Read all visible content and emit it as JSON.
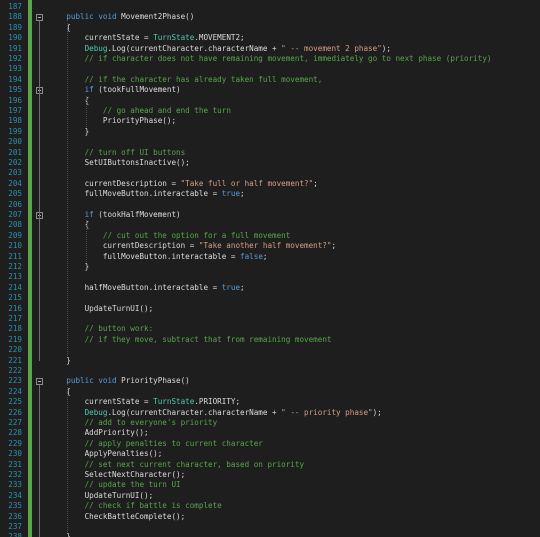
{
  "editor": {
    "colors": {
      "background": "#1e1e1e",
      "line_number": "#2b91af",
      "keyword": "#569cd6",
      "type": "#4ec9b0",
      "string": "#d69d85",
      "comment": "#57a64a",
      "text": "#dcdcdc",
      "change_bar": "#57a64a"
    },
    "fold_icon": "collapse-minus-icon",
    "lines": [
      {
        "n": "187",
        "segs": []
      },
      {
        "n": "188",
        "fold": true,
        "segs": [
          {
            "t": "    ",
            "c": "tx"
          },
          {
            "t": "public",
            "c": "kw"
          },
          {
            "t": " ",
            "c": "tx"
          },
          {
            "t": "void",
            "c": "kw"
          },
          {
            "t": " Movement2Phase()",
            "c": "tx"
          }
        ]
      },
      {
        "n": "189",
        "segs": [
          {
            "t": "    {",
            "c": "tx"
          }
        ]
      },
      {
        "n": "190",
        "segs": [
          {
            "t": "        currentState = ",
            "c": "tx"
          },
          {
            "t": "TurnState",
            "c": "ty"
          },
          {
            "t": ".MOVEMENT2;",
            "c": "tx"
          }
        ]
      },
      {
        "n": "191",
        "segs": [
          {
            "t": "        ",
            "c": "tx"
          },
          {
            "t": "Debug",
            "c": "ty"
          },
          {
            "t": ".Log(currentCharacter.characterName + ",
            "c": "tx"
          },
          {
            "t": "\" -- movement 2 phase\"",
            "c": "st"
          },
          {
            "t": ");",
            "c": "tx"
          }
        ]
      },
      {
        "n": "192",
        "segs": [
          {
            "t": "        ",
            "c": "tx"
          },
          {
            "t": "// if character does not have remaining movement, immediately go to next phase (priority)",
            "c": "cm"
          }
        ]
      },
      {
        "n": "193",
        "segs": []
      },
      {
        "n": "194",
        "segs": [
          {
            "t": "        ",
            "c": "tx"
          },
          {
            "t": "// if the character has already taken full movement,",
            "c": "cm"
          }
        ]
      },
      {
        "n": "195",
        "fold": true,
        "segs": [
          {
            "t": "        ",
            "c": "tx"
          },
          {
            "t": "if",
            "c": "kw"
          },
          {
            "t": " (tookFullMovement)",
            "c": "tx"
          }
        ]
      },
      {
        "n": "196",
        "segs": [
          {
            "t": "        {",
            "c": "tx"
          }
        ]
      },
      {
        "n": "197",
        "segs": [
          {
            "t": "            ",
            "c": "tx"
          },
          {
            "t": "// go ahead and end the turn",
            "c": "cm"
          }
        ]
      },
      {
        "n": "198",
        "segs": [
          {
            "t": "            PriorityPhase();",
            "c": "tx"
          }
        ]
      },
      {
        "n": "199",
        "segs": [
          {
            "t": "        }",
            "c": "tx"
          }
        ]
      },
      {
        "n": "200",
        "segs": []
      },
      {
        "n": "201",
        "segs": [
          {
            "t": "        ",
            "c": "tx"
          },
          {
            "t": "// turn off UI buttons",
            "c": "cm"
          }
        ]
      },
      {
        "n": "202",
        "segs": [
          {
            "t": "        SetUIButtonsInactive();",
            "c": "tx"
          }
        ]
      },
      {
        "n": "203",
        "segs": []
      },
      {
        "n": "204",
        "segs": [
          {
            "t": "        currentDescription = ",
            "c": "tx"
          },
          {
            "t": "\"Take full or half movement?\"",
            "c": "st"
          },
          {
            "t": ";",
            "c": "tx"
          }
        ]
      },
      {
        "n": "205",
        "segs": [
          {
            "t": "        fullMoveButton.interactable = ",
            "c": "tx"
          },
          {
            "t": "true",
            "c": "kw"
          },
          {
            "t": ";",
            "c": "tx"
          }
        ]
      },
      {
        "n": "206",
        "segs": []
      },
      {
        "n": "207",
        "fold": true,
        "segs": [
          {
            "t": "        ",
            "c": "tx"
          },
          {
            "t": "if",
            "c": "kw"
          },
          {
            "t": " (tookHalfMovement)",
            "c": "tx"
          }
        ]
      },
      {
        "n": "208",
        "segs": [
          {
            "t": "        {",
            "c": "tx"
          }
        ]
      },
      {
        "n": "209",
        "segs": [
          {
            "t": "            ",
            "c": "tx"
          },
          {
            "t": "// cut out the option for a full movement",
            "c": "cm"
          }
        ]
      },
      {
        "n": "210",
        "segs": [
          {
            "t": "            currentDescription = ",
            "c": "tx"
          },
          {
            "t": "\"Take another half movement?\"",
            "c": "st"
          },
          {
            "t": ";",
            "c": "tx"
          }
        ]
      },
      {
        "n": "211",
        "segs": [
          {
            "t": "            fullMoveButton.interactable = ",
            "c": "tx"
          },
          {
            "t": "false",
            "c": "kw"
          },
          {
            "t": ";",
            "c": "tx"
          }
        ]
      },
      {
        "n": "212",
        "segs": [
          {
            "t": "        }",
            "c": "tx"
          }
        ]
      },
      {
        "n": "213",
        "segs": []
      },
      {
        "n": "214",
        "segs": [
          {
            "t": "        halfMoveButton.interactable = ",
            "c": "tx"
          },
          {
            "t": "true",
            "c": "kw"
          },
          {
            "t": ";",
            "c": "tx"
          }
        ]
      },
      {
        "n": "215",
        "segs": []
      },
      {
        "n": "216",
        "segs": [
          {
            "t": "        UpdateTurnUI();",
            "c": "tx"
          }
        ]
      },
      {
        "n": "217",
        "segs": []
      },
      {
        "n": "218",
        "segs": [
          {
            "t": "        ",
            "c": "tx"
          },
          {
            "t": "// button work:",
            "c": "cm"
          }
        ]
      },
      {
        "n": "219",
        "segs": [
          {
            "t": "        ",
            "c": "tx"
          },
          {
            "t": "// if they move, subtract that from remaining movement",
            "c": "cm"
          }
        ]
      },
      {
        "n": "220",
        "segs": []
      },
      {
        "n": "221",
        "segs": [
          {
            "t": "    }",
            "c": "tx"
          }
        ]
      },
      {
        "n": "222",
        "segs": []
      },
      {
        "n": "223",
        "fold": true,
        "segs": [
          {
            "t": "    ",
            "c": "tx"
          },
          {
            "t": "public",
            "c": "kw"
          },
          {
            "t": " ",
            "c": "tx"
          },
          {
            "t": "void",
            "c": "kw"
          },
          {
            "t": " PriorityPhase()",
            "c": "tx"
          }
        ]
      },
      {
        "n": "224",
        "segs": [
          {
            "t": "    {",
            "c": "tx"
          }
        ]
      },
      {
        "n": "225",
        "segs": [
          {
            "t": "        currentState = ",
            "c": "tx"
          },
          {
            "t": "TurnState",
            "c": "ty"
          },
          {
            "t": ".PRIORITY;",
            "c": "tx"
          }
        ]
      },
      {
        "n": "226",
        "segs": [
          {
            "t": "        ",
            "c": "tx"
          },
          {
            "t": "Debug",
            "c": "ty"
          },
          {
            "t": ".Log(currentCharacter.characterName + ",
            "c": "tx"
          },
          {
            "t": "\" -- priority phase\"",
            "c": "st"
          },
          {
            "t": ");",
            "c": "tx"
          }
        ]
      },
      {
        "n": "227",
        "segs": [
          {
            "t": "        ",
            "c": "tx"
          },
          {
            "t": "// add to everyone's priority",
            "c": "cm"
          }
        ]
      },
      {
        "n": "228",
        "segs": [
          {
            "t": "        AddPriority();",
            "c": "tx"
          }
        ]
      },
      {
        "n": "229",
        "segs": [
          {
            "t": "        ",
            "c": "tx"
          },
          {
            "t": "// apply penalties to current character",
            "c": "cm"
          }
        ]
      },
      {
        "n": "230",
        "segs": [
          {
            "t": "        ApplyPenalties();",
            "c": "tx"
          }
        ]
      },
      {
        "n": "231",
        "segs": [
          {
            "t": "        ",
            "c": "tx"
          },
          {
            "t": "// set next current character, based on priority",
            "c": "cm"
          }
        ]
      },
      {
        "n": "232",
        "segs": [
          {
            "t": "        SelectNextCharacter();",
            "c": "tx"
          }
        ]
      },
      {
        "n": "233",
        "segs": [
          {
            "t": "        ",
            "c": "tx"
          },
          {
            "t": "// update the turn UI",
            "c": "cm"
          }
        ]
      },
      {
        "n": "234",
        "segs": [
          {
            "t": "        UpdateTurnUI();",
            "c": "tx"
          }
        ]
      },
      {
        "n": "235",
        "segs": [
          {
            "t": "        ",
            "c": "tx"
          },
          {
            "t": "// check if battle is complete",
            "c": "cm"
          }
        ]
      },
      {
        "n": "236",
        "segs": [
          {
            "t": "        CheckBattleComplete();",
            "c": "tx"
          }
        ]
      },
      {
        "n": "237",
        "segs": []
      },
      {
        "n": "238",
        "segs": [
          {
            "t": "    }",
            "c": "tx"
          }
        ]
      }
    ]
  }
}
